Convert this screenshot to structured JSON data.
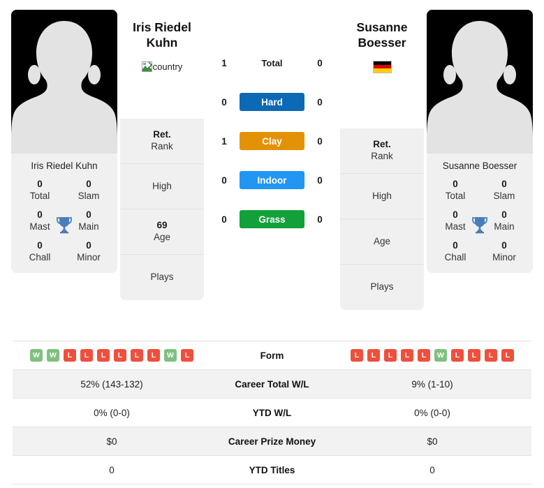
{
  "players": {
    "left": {
      "display_name_lines": [
        "Iris Riedel",
        "Kuhn"
      ],
      "card_name": "Iris Riedel Kuhn",
      "country_icon": "broken-image-icon",
      "country_alt": "country",
      "avatar_icon": "player-silhouette-avatar",
      "titles": [
        {
          "num": "0",
          "label": "Total"
        },
        {
          "num": "0",
          "label": "Slam"
        },
        {
          "num": "0",
          "label": "Mast"
        },
        {
          "num": "0",
          "label": "Main"
        },
        {
          "num": "0",
          "label": "Chall"
        },
        {
          "num": "0",
          "label": "Minor"
        }
      ],
      "trophy_icon": "trophy-icon",
      "info": [
        {
          "value": "Ret.",
          "label": "Rank"
        },
        {
          "value": "",
          "label": "High"
        },
        {
          "value": "69",
          "label": "Age"
        },
        {
          "value": "",
          "label": "Plays"
        }
      ],
      "form": [
        "W",
        "W",
        "L",
        "L",
        "L",
        "L",
        "L",
        "L",
        "W",
        "L"
      ]
    },
    "right": {
      "display_name_lines": [
        "Susanne",
        "Boesser"
      ],
      "card_name": "Susanne Boesser",
      "country_icon": "flag-germany-icon",
      "country_alt": "Germany",
      "avatar_icon": "player-silhouette-avatar",
      "titles": [
        {
          "num": "0",
          "label": "Total"
        },
        {
          "num": "0",
          "label": "Slam"
        },
        {
          "num": "0",
          "label": "Mast"
        },
        {
          "num": "0",
          "label": "Main"
        },
        {
          "num": "0",
          "label": "Chall"
        },
        {
          "num": "0",
          "label": "Minor"
        }
      ],
      "trophy_icon": "trophy-icon",
      "info": [
        {
          "value": "Ret.",
          "label": "Rank"
        },
        {
          "value": "",
          "label": "High"
        },
        {
          "value": "",
          "label": "Age"
        },
        {
          "value": "",
          "label": "Plays"
        }
      ],
      "form": [
        "L",
        "L",
        "L",
        "L",
        "L",
        "W",
        "L",
        "L",
        "L",
        "L"
      ]
    }
  },
  "head_to_head": [
    {
      "label": "Total",
      "left": "1",
      "right": "0",
      "color": "",
      "plain": true
    },
    {
      "label": "Hard",
      "left": "0",
      "right": "0",
      "color": "#0b69b5",
      "plain": false
    },
    {
      "label": "Clay",
      "left": "1",
      "right": "0",
      "color": "#e39208",
      "plain": false
    },
    {
      "label": "Indoor",
      "left": "0",
      "right": "0",
      "color": "#2196f3",
      "plain": false
    },
    {
      "label": "Grass",
      "left": "0",
      "right": "0",
      "color": "#12a03a",
      "plain": false
    }
  ],
  "comparison_rows": [
    {
      "label": "Form",
      "type": "form"
    },
    {
      "label": "Career Total W/L",
      "type": "text",
      "left": "52% (143-132)",
      "right": "9% (1-10)"
    },
    {
      "label": "YTD W/L",
      "type": "text",
      "left": "0% (0-0)",
      "right": "0% (0-0)"
    },
    {
      "label": "Career Prize Money",
      "type": "text",
      "left": "$0",
      "right": "$0"
    },
    {
      "label": "YTD Titles",
      "type": "text",
      "left": "0",
      "right": "0"
    }
  ],
  "colors": {
    "card_bg": "#f0f0f0",
    "page_bg": "#ffffff",
    "form_win": "#7ec17e",
    "form_loss": "#ef4f3c",
    "trophy": "#4a7ebb",
    "row_stripe": "#f2f2f2"
  }
}
